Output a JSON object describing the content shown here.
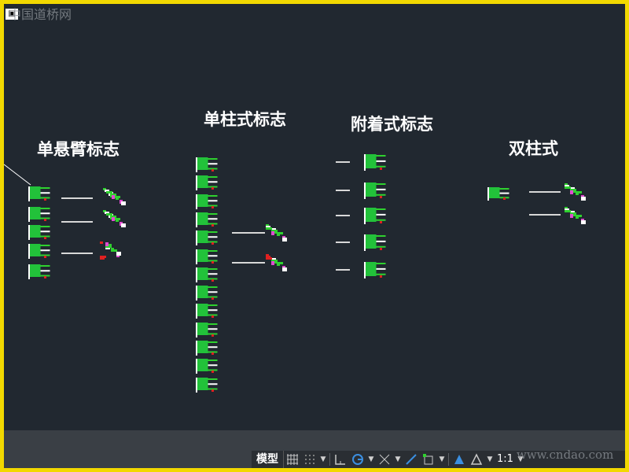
{
  "window": {
    "corner_icon": "viewport-control-icon",
    "accent": "#f2d800",
    "background": "#212830"
  },
  "watermarks": {
    "top_left": "中国道桥网",
    "bottom_right": "www.cndao.com"
  },
  "titles": {
    "single_cantilever": "单悬臂标志",
    "single_column": "单柱式标志",
    "attached": "附着式标志",
    "double_column": "双柱式"
  },
  "statusbar": {
    "model_tab": "模型",
    "scale": "1:1",
    "icons": [
      "grid-icon",
      "snap-grid-icon",
      "ortho-icon",
      "polar-tracking-icon",
      "object-snap-tracking-icon",
      "lineweight-icon",
      "selection-cycling-icon",
      "annotation-visibility-icon",
      "workspace-icon"
    ]
  }
}
